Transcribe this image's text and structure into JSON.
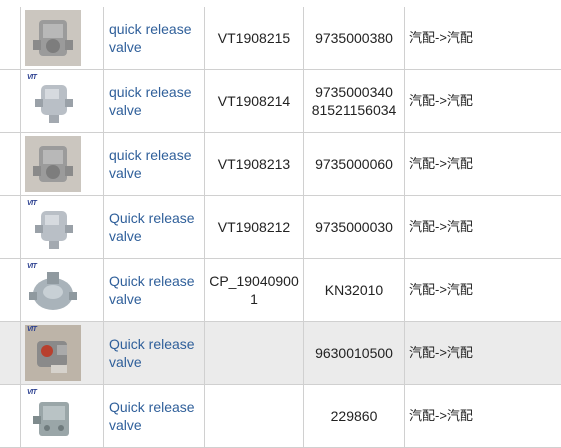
{
  "table": {
    "rows": [
      {
        "name": "quick release valve",
        "code": "VT1908215",
        "oe": "9735000380",
        "category": "汽配->汽配",
        "image": "valve-photo",
        "logo": "",
        "highlight": false
      },
      {
        "name": "quick release valve",
        "code": "VT1908214",
        "oe": "9735000340\n81521156034",
        "category": "汽配->汽配",
        "image": "valve-silver",
        "logo": "VIT",
        "highlight": false
      },
      {
        "name": "quick release valve",
        "code": "VT1908213",
        "oe": "9735000060",
        "category": "汽配->汽配",
        "image": "valve-photo",
        "logo": "",
        "highlight": false
      },
      {
        "name": "Quick release valve",
        "code": "VT1908212",
        "oe": "9735000030",
        "category": "汽配->汽配",
        "image": "valve-silver",
        "logo": "VIT",
        "highlight": false
      },
      {
        "name": "Quick release valve",
        "code": "CP_190409001",
        "oe": "KN32010",
        "category": "汽配->汽配",
        "image": "valve-round",
        "logo": "VIT",
        "highlight": false
      },
      {
        "name": "Quick release valve",
        "code": "",
        "oe": "9630010500",
        "category": "汽配->汽配",
        "image": "valve-photo-red",
        "logo": "VIT",
        "highlight": true
      },
      {
        "name": "Quick release valve",
        "code": "",
        "oe": "229860",
        "category": "汽配->汽配",
        "image": "valve-block",
        "logo": "VIT",
        "highlight": false
      }
    ]
  }
}
